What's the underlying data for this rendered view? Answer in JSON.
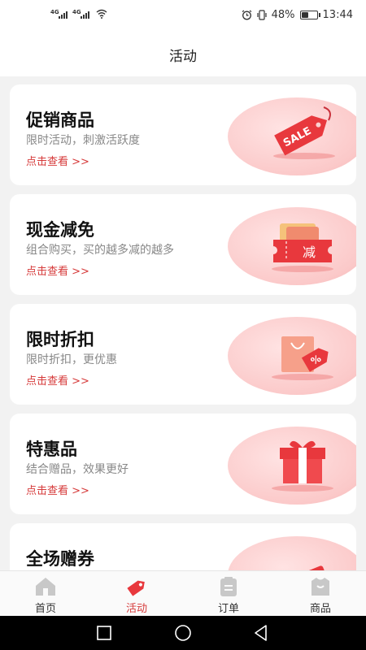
{
  "status_bar": {
    "net1": "4G",
    "net2": "4G",
    "battery": "48%",
    "time": "13:44"
  },
  "header": {
    "title": "活动"
  },
  "cards": [
    {
      "title": "促销商品",
      "desc": "限时活动，刺激活跃度",
      "link": "点击查看 >>",
      "icon": "sale-tag-icon",
      "badge": "SALE"
    },
    {
      "title": "现金减免",
      "desc": "组合购买，买的越多减的越多",
      "link": "点击查看 >>",
      "icon": "cash-coupon-icon",
      "badge": "减"
    },
    {
      "title": "限时折扣",
      "desc": "限时折扣，更优惠",
      "link": "点击查看 >>",
      "icon": "discount-bag-icon",
      "badge": "%"
    },
    {
      "title": "特惠品",
      "desc": "结合赠品，效果更好",
      "link": "点击查看 >>",
      "icon": "gift-box-icon"
    },
    {
      "title": "全场赠券",
      "desc": "",
      "link": "",
      "icon": "ticket-icon"
    }
  ],
  "tabs": [
    {
      "label": "首页",
      "icon": "home-icon"
    },
    {
      "label": "活动",
      "icon": "activity-tag-icon",
      "active": true
    },
    {
      "label": "订单",
      "icon": "order-icon"
    },
    {
      "label": "商品",
      "icon": "goods-icon"
    }
  ],
  "colors": {
    "accent": "#d63a3a",
    "blob": "#fbc9c9",
    "tab_inactive": "#cccccc"
  }
}
